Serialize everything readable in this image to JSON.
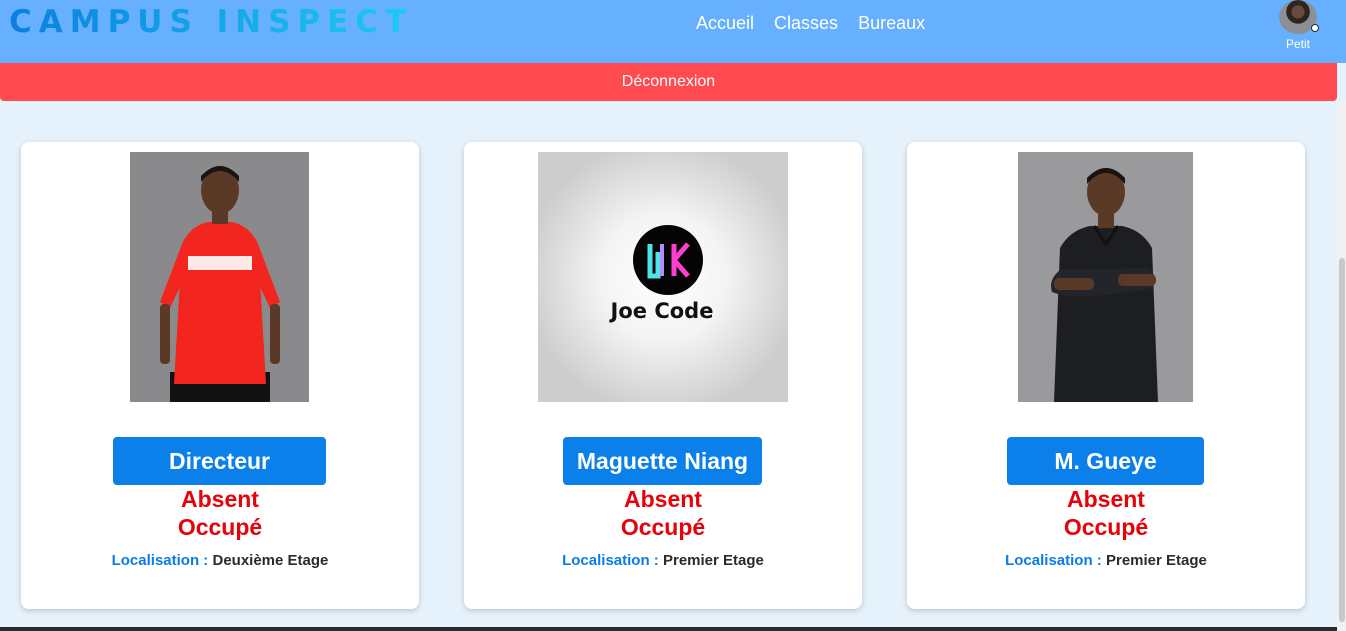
{
  "brand": "CAMPUS INSPECT",
  "nav": {
    "links": [
      "Accueil",
      "Classes",
      "Bureaux"
    ]
  },
  "user": {
    "name": "Petit"
  },
  "logout_label": "Déconnexion",
  "cards": [
    {
      "name": "Directeur",
      "status": "Absent",
      "availability": "Occupé",
      "location_label": "Localisation",
      "location_sep": " : ",
      "location_value": "Deuxième Etage",
      "photo": "person-red-shirt-photo"
    },
    {
      "name": "Maguette Niang",
      "status": "Absent",
      "availability": "Occupé",
      "location_label": "Localisation",
      "location_sep": " : ",
      "location_value": "Premier Etage",
      "photo": "joe-code-logo",
      "logo_text": "Joe Code"
    },
    {
      "name": "M. Gueye",
      "status": "Absent",
      "availability": "Occupé",
      "location_label": "Localisation",
      "location_sep": " : ",
      "location_value": "Premier Etage",
      "photo": "person-black-shirt-photo"
    }
  ],
  "colors": {
    "navbar": "#66b0ff",
    "logout": "#ff4a4f",
    "name_button": "#0b7fea",
    "status_text": "#e8000a",
    "page_bg": "#e6f2fb"
  }
}
